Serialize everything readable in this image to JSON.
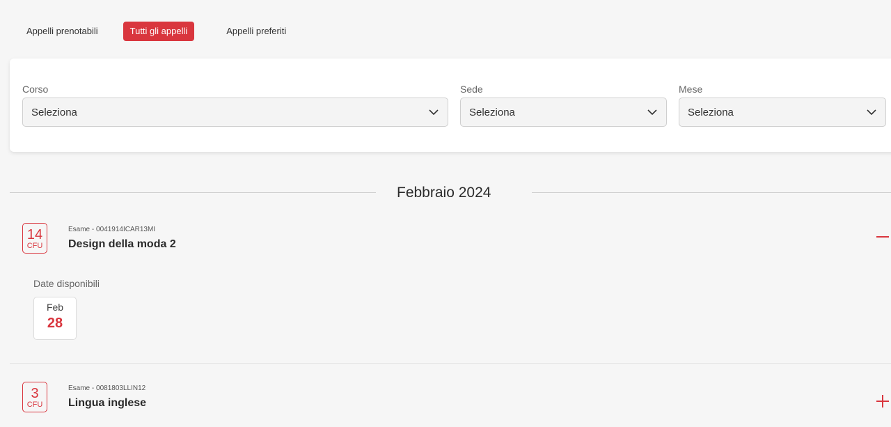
{
  "tabs": [
    {
      "label": "Appelli prenotabili",
      "active": false
    },
    {
      "label": "Tutti gli appelli",
      "active": true
    },
    {
      "label": "Appelli preferiti",
      "active": false
    }
  ],
  "filters": {
    "corso": {
      "label": "Corso",
      "value": "Seleziona"
    },
    "sede": {
      "label": "Sede",
      "value": "Seleziona"
    },
    "mese": {
      "label": "Mese",
      "value": "Seleziona"
    }
  },
  "month": {
    "title": "Febbraio 2024"
  },
  "exams": [
    {
      "cfu": "14",
      "cfu_label": "CFU",
      "code": "Esame - 0041914ICAR13MI",
      "name": "Design della moda 2",
      "expanded": true,
      "toggle_icon": "minus-icon",
      "dates_label": "Date disponibili",
      "dates": [
        {
          "month": "Feb",
          "day": "28"
        }
      ]
    },
    {
      "cfu": "3",
      "cfu_label": "CFU",
      "code": "Esame - 0081803LLIN12",
      "name": "Lingua inglese",
      "expanded": false,
      "toggle_icon": "plus-icon"
    }
  ],
  "colors": {
    "accent": "#d9363e",
    "background": "#f6f6f6",
    "card": "#ffffff"
  }
}
